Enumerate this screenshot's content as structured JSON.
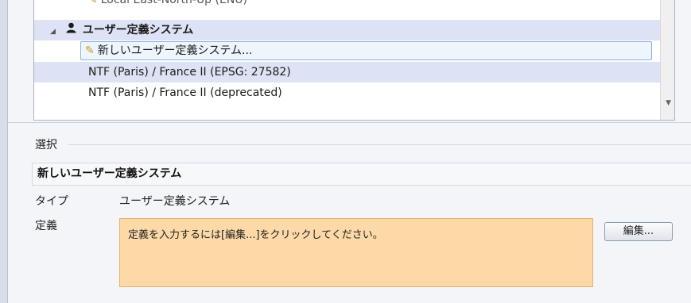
{
  "crs_list": {
    "partial_top_item": "Local East-North-Up (ENU)",
    "group": {
      "label": "ユーザー定義システム",
      "expanded": true
    },
    "new_item": "新しいユーザー定義システム...",
    "items": [
      {
        "label": "NTF (Paris) / France II (EPSG: 27582)",
        "selected": true
      },
      {
        "label": "NTF (Paris) / France II (deprecated)",
        "selected": false
      }
    ]
  },
  "selection": {
    "section_title": "選択",
    "name": "新しいユーザー定義システム",
    "type_label": "タイプ",
    "type_value": "ユーザー定義システム",
    "definition_label": "定義",
    "definition_hint": "定義を入力するには[編集...]をクリックしてください。",
    "edit_button": "編集..."
  },
  "colors": {
    "selected_row": "#dde2f4",
    "definition_box": "#fdd9a7"
  }
}
